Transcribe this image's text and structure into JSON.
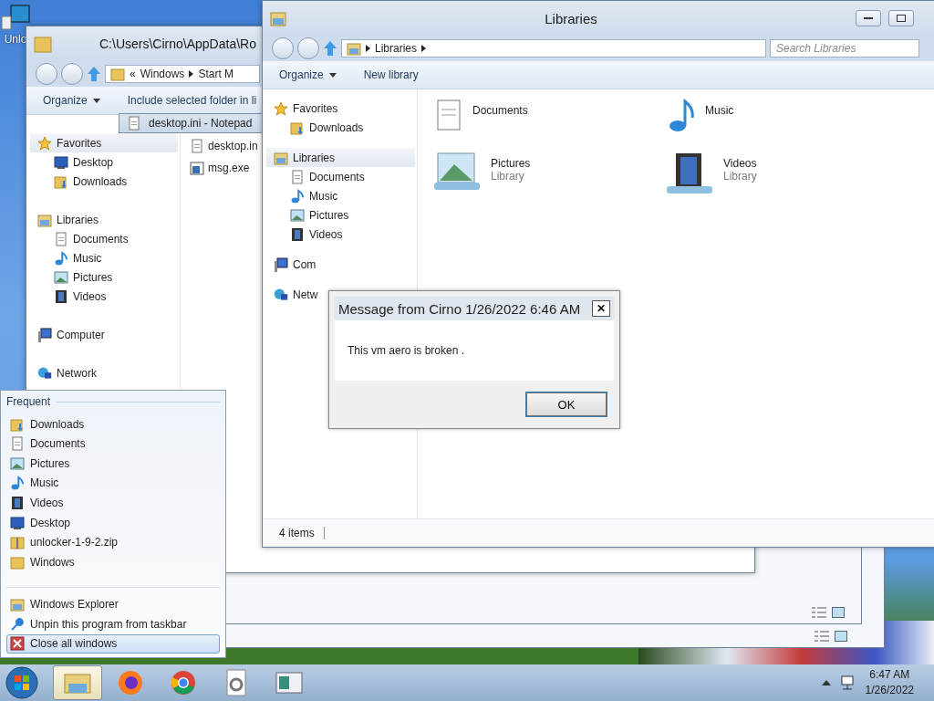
{
  "desktop": {
    "icons": [
      {
        "label": "Unlo"
      }
    ]
  },
  "back_explorer": {
    "title": "C:\\Users\\Cirno\\AppData\\Ro",
    "address": [
      "«",
      "Windows",
      "Start M"
    ],
    "toolbar": [
      "Organize",
      "Include selected folder in li"
    ],
    "nav": [
      {
        "label": "Favorites",
        "kind": "star",
        "selected": true,
        "children": [
          {
            "label": "Desktop",
            "kind": "desktop",
            "selected": false
          },
          {
            "label": "Downloads",
            "kind": "download",
            "selected": false
          }
        ]
      },
      {
        "label": "Libraries",
        "kind": "library",
        "selected": false,
        "children": [
          {
            "label": "Documents",
            "kind": "document",
            "selected": false
          },
          {
            "label": "Music",
            "kind": "music",
            "selected": false
          },
          {
            "label": "Pictures",
            "kind": "picture",
            "selected": false
          },
          {
            "label": "Videos",
            "kind": "video",
            "selected": false
          }
        ]
      },
      {
        "label": "Computer",
        "kind": "computer",
        "selected": false
      },
      {
        "label": "Network",
        "kind": "network",
        "selected": false
      }
    ],
    "files": [
      {
        "label": "desktop.in",
        "kind": "document"
      },
      {
        "label": "msg.exe",
        "kind": "program"
      }
    ]
  },
  "notepad": {
    "title": "desktop.ini - Notepad"
  },
  "libraries": {
    "title": "Libraries",
    "address": [
      "Libraries"
    ],
    "search": {
      "placeholder": "Search Libraries"
    },
    "toolbar": [
      "Organize",
      "New library"
    ],
    "nav": [
      {
        "label": "Favorites",
        "kind": "star",
        "selected": false,
        "children": [
          {
            "label": "Downloads",
            "kind": "download",
            "selected": false
          }
        ]
      },
      {
        "label": "Libraries",
        "kind": "library",
        "selected": true,
        "children": [
          {
            "label": "Documents",
            "kind": "document",
            "selected": false
          },
          {
            "label": "Music",
            "kind": "music",
            "selected": false
          },
          {
            "label": "Pictures",
            "kind": "picture",
            "selected": false
          },
          {
            "label": "Videos",
            "kind": "video",
            "selected": false
          }
        ]
      },
      {
        "label": "Com",
        "kind": "computer",
        "selected": false
      },
      {
        "label": "Netw",
        "kind": "network",
        "selected": false
      }
    ],
    "items": [
      {
        "label": "Documents",
        "kind": "document"
      },
      {
        "label": "Music",
        "kind": "music"
      },
      {
        "label": "Pictures",
        "kind": "picture",
        "sub": "Library"
      },
      {
        "label": "Videos",
        "kind": "video",
        "sub": "Library"
      }
    ],
    "status": "4 items"
  },
  "dialog": {
    "title": "Message from Cirno 1/26/2022 6:46 AM",
    "close": "✕",
    "message": "This vm aero is broken .",
    "button": "OK"
  },
  "jump_list": {
    "heading": "Frequent",
    "items": [
      {
        "label": "Downloads",
        "kind": "download"
      },
      {
        "label": "Documents",
        "kind": "document"
      },
      {
        "label": "Pictures",
        "kind": "picture"
      },
      {
        "label": "Music",
        "kind": "music"
      },
      {
        "label": "Videos",
        "kind": "video"
      },
      {
        "label": "Desktop",
        "kind": "desktop"
      },
      {
        "label": "unlocker-1-9-2.zip",
        "kind": "zip"
      },
      {
        "label": "Windows",
        "kind": "folder"
      }
    ],
    "tasks": [
      {
        "label": "Windows Explorer",
        "kind": "library",
        "selected": false
      },
      {
        "label": "Unpin this program from taskbar",
        "kind": "pin",
        "selected": false
      },
      {
        "label": "Close all windows",
        "kind": "close",
        "selected": true
      }
    ]
  },
  "taskbar": {
    "apps": [
      {
        "kind": "explorer",
        "selected": true
      },
      {
        "kind": "firefox",
        "selected": false
      },
      {
        "kind": "chrome",
        "selected": false
      },
      {
        "kind": "settings",
        "selected": false
      },
      {
        "kind": "window",
        "selected": false
      }
    ],
    "time": "6:47 AM",
    "date": "1/26/2022"
  }
}
